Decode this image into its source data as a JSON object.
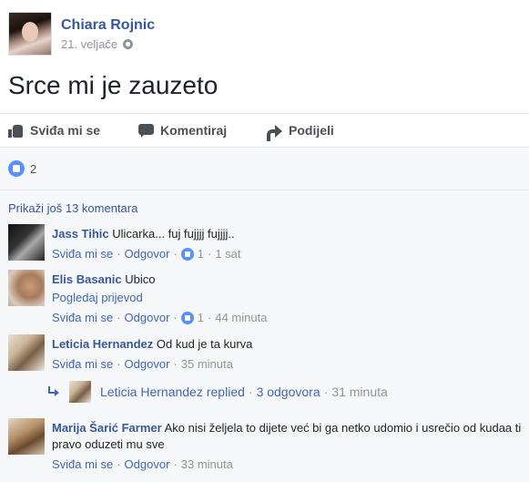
{
  "post": {
    "author": "Chiara Rojnic",
    "date": "21. veljače",
    "privacy_icon": "globe-icon",
    "text": "Srce mi je zauzeto"
  },
  "actions": {
    "like": "Sviđa mi se",
    "comment": "Komentiraj",
    "share": "Podijeli"
  },
  "likes": {
    "count": "2"
  },
  "more_comments": "Prikaži još 13 komentara",
  "comments": [
    {
      "name": "Jass Tihic",
      "text": "Ulicarka... fuj fujjjj fujjjj..",
      "like": "Sviđa mi se",
      "reply": "Odgovor",
      "likes": "1",
      "time": "1 sat"
    },
    {
      "name": "Elis Basanic",
      "text": "Ubico",
      "translate": "Pogledaj prijevod",
      "like": "Sviđa mi se",
      "reply": "Odgovor",
      "likes": "1",
      "time": "44 minuta"
    },
    {
      "name": "Leticia Hernandez",
      "text": "Od kud je ta kurva",
      "like": "Sviđa mi se",
      "reply": "Odgovor",
      "time": "35 minuta"
    },
    {
      "name": "Marija Šarić Farmer",
      "text": "Ako nisi željela to dijete već bi ga netko udomio i usrečio od kudaa ti pravo oduzeti mu sve",
      "like": "Sviđa mi se",
      "reply": "Odgovor",
      "time": "33 minuta"
    }
  ],
  "replies": {
    "author": "Leticia Hernandez",
    "action": "replied",
    "count_label": "3 odgovora",
    "time": "31 minuta"
  }
}
